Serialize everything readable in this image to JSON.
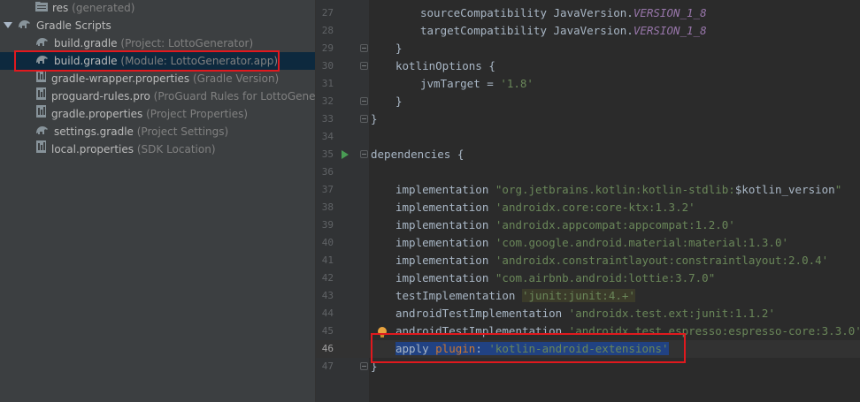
{
  "project": {
    "items": [
      {
        "name": "res",
        "hint": "(generated)",
        "icon": "folder-icon"
      },
      {
        "name": "Gradle Scripts",
        "hint": "",
        "icon": "gradle-icon"
      },
      {
        "name": "build.gradle",
        "hint": "(Project: LottoGenerator)",
        "icon": "gradle-icon"
      },
      {
        "name": "build.gradle",
        "hint": "(Module: LottoGenerator.app)",
        "icon": "gradle-icon"
      },
      {
        "name": "gradle-wrapper.properties",
        "hint": "(Gradle Version)",
        "icon": "properties-file-icon"
      },
      {
        "name": "proguard-rules.pro",
        "hint": "(ProGuard Rules for LottoGenerator.a",
        "icon": "properties-file-icon"
      },
      {
        "name": "gradle.properties",
        "hint": "(Project Properties)",
        "icon": "properties-file-icon"
      },
      {
        "name": "settings.gradle",
        "hint": "(Project Settings)",
        "icon": "gradle-icon"
      },
      {
        "name": "local.properties",
        "hint": "(SDK Location)",
        "icon": "properties-file-icon"
      }
    ]
  },
  "editor": {
    "line_numbers": [
      "27",
      "28",
      "29",
      "30",
      "31",
      "32",
      "33",
      "34",
      "35",
      "36",
      "37",
      "38",
      "39",
      "40",
      "41",
      "42",
      "43",
      "44",
      "45",
      "46",
      "47"
    ],
    "current_line": "46",
    "lines": {
      "l27": {
        "a": "sourceCompatibility JavaVersion.",
        "b": "VERSION_1_8"
      },
      "l28": {
        "a": "targetCompatibility JavaVersion.",
        "b": "VERSION_1_8"
      },
      "l29": "}",
      "l30": "kotlinOptions {",
      "l31": {
        "a": "jvmTarget = ",
        "b": "'1.8'"
      },
      "l32": "}",
      "l33": "}",
      "l35": "dependencies {",
      "l37": {
        "a": "implementation ",
        "b": "\"org.jetbrains.kotlin:kotlin-stdlib:",
        "c": "$kotlin_version",
        "d": "\""
      },
      "l38": {
        "a": "implementation ",
        "b": "'androidx.core:core-ktx:1.3.2'"
      },
      "l39": {
        "a": "implementation ",
        "b": "'androidx.appcompat:appcompat:1.2.0'"
      },
      "l40": {
        "a": "implementation ",
        "b": "'com.google.android.material:material:1.3.0'"
      },
      "l41": {
        "a": "implementation ",
        "b": "'androidx.constraintlayout:constraintlayout:2.0.4'"
      },
      "l42": {
        "a": "implementation ",
        "b": "\"com.airbnb.android:lottie:3.7.0\""
      },
      "l43": {
        "a": "testImplementation ",
        "b": "'junit:junit:4.+'"
      },
      "l44": {
        "a": "androidTestImplementation ",
        "b": "'androidx.test.ext:junit:1.1.2'"
      },
      "l45": {
        "a": "androidTestImplementation ",
        "b": "'androidx.test.espresso:espresso-core:3.3.0'"
      },
      "l46": {
        "a": "apply ",
        "b": "plugin",
        "c": ": ",
        "d": "'kotlin-android-extensions'"
      },
      "l47": "}"
    }
  },
  "colors": {
    "highlight_box": "#e0191e",
    "selection": "#214283",
    "string": "#6a8759"
  }
}
